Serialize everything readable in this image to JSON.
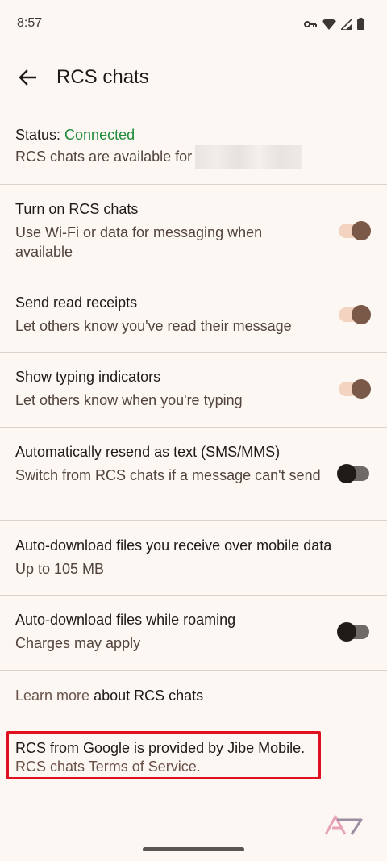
{
  "status_bar": {
    "time": "8:57",
    "icons": [
      "vpn-key-icon",
      "wifi-icon",
      "cell-signal-icon",
      "battery-icon"
    ]
  },
  "header": {
    "title": "RCS chats",
    "back_icon": "arrow-back-icon"
  },
  "status": {
    "label": "Status: ",
    "value": "Connected",
    "available_text": "RCS chats are available for"
  },
  "settings": [
    {
      "title": "Turn on RCS chats",
      "subtitle": "Use Wi-Fi or data for messaging when available",
      "toggle": "on"
    },
    {
      "title": "Send read receipts",
      "subtitle": "Let others know you've read their message",
      "toggle": "on"
    },
    {
      "title": "Show typing indicators",
      "subtitle": "Let others know when you're typing",
      "toggle": "on"
    },
    {
      "title": "Automatically resend as text (SMS/MMS)",
      "subtitle": "Switch from RCS chats if a message can't send",
      "toggle": "off"
    },
    {
      "title": "Auto-download files you receive over mobile data",
      "subtitle": "Up to 105 MB"
    },
    {
      "title": "Auto-download files while roaming",
      "subtitle": "Charges may apply",
      "toggle": "off"
    }
  ],
  "learn_more": {
    "link": "Learn more",
    "rest": " about RCS chats"
  },
  "footer": {
    "provider_text": "RCS from Google is provided by Jibe Mobile.",
    "terms_link": "RCS chats Terms of Service."
  },
  "colors": {
    "background": "#fcf7f3",
    "connected": "#1f8a3a",
    "toggle_on_thumb": "#7a5948",
    "highlight": "#e0101e"
  }
}
